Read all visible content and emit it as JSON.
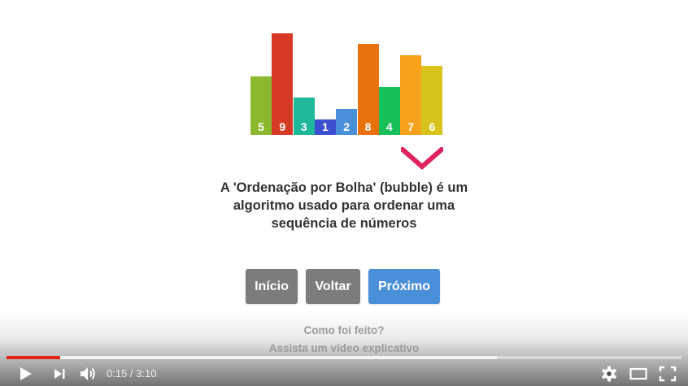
{
  "chart_data": {
    "type": "bar",
    "categories": [
      "5",
      "9",
      "3",
      "1",
      "2",
      "8",
      "4",
      "7",
      "6"
    ],
    "values": [
      5,
      9,
      3,
      1,
      2,
      8,
      4,
      7,
      6
    ],
    "colors": [
      "#8cb830",
      "#d63a26",
      "#1fb89a",
      "#3b4fd0",
      "#4a90d9",
      "#e8720c",
      "#18c05a",
      "#f7a21a",
      "#d8c21c"
    ]
  },
  "slide": {
    "line1": "A 'Ordenação por Bolha' (bubble) é um",
    "line2": "algoritmo usado para ordenar uma",
    "line3": "sequência de números",
    "chevron_icon": "chevron-down-icon",
    "accent_color": "#e0245e"
  },
  "nav": {
    "inicio_label": "Início",
    "voltar_label": "Voltar",
    "proximo_label": "Próximo",
    "button_gray": "#7c7c7c",
    "button_blue": "#4a90d9"
  },
  "footer": {
    "how_made": "Como foi feito?",
    "watch_video": "Assista um vídeo explicativo"
  },
  "player": {
    "current_time": "0:15",
    "separator": " / ",
    "duration": "3:10",
    "progress_fraction": 0.079,
    "buffered_fraction": 0.727,
    "progress_color": "#e62117",
    "icons": [
      "play-icon",
      "next-icon",
      "volume-icon",
      "settings-icon",
      "theater-mode-icon",
      "fullscreen-icon"
    ]
  }
}
